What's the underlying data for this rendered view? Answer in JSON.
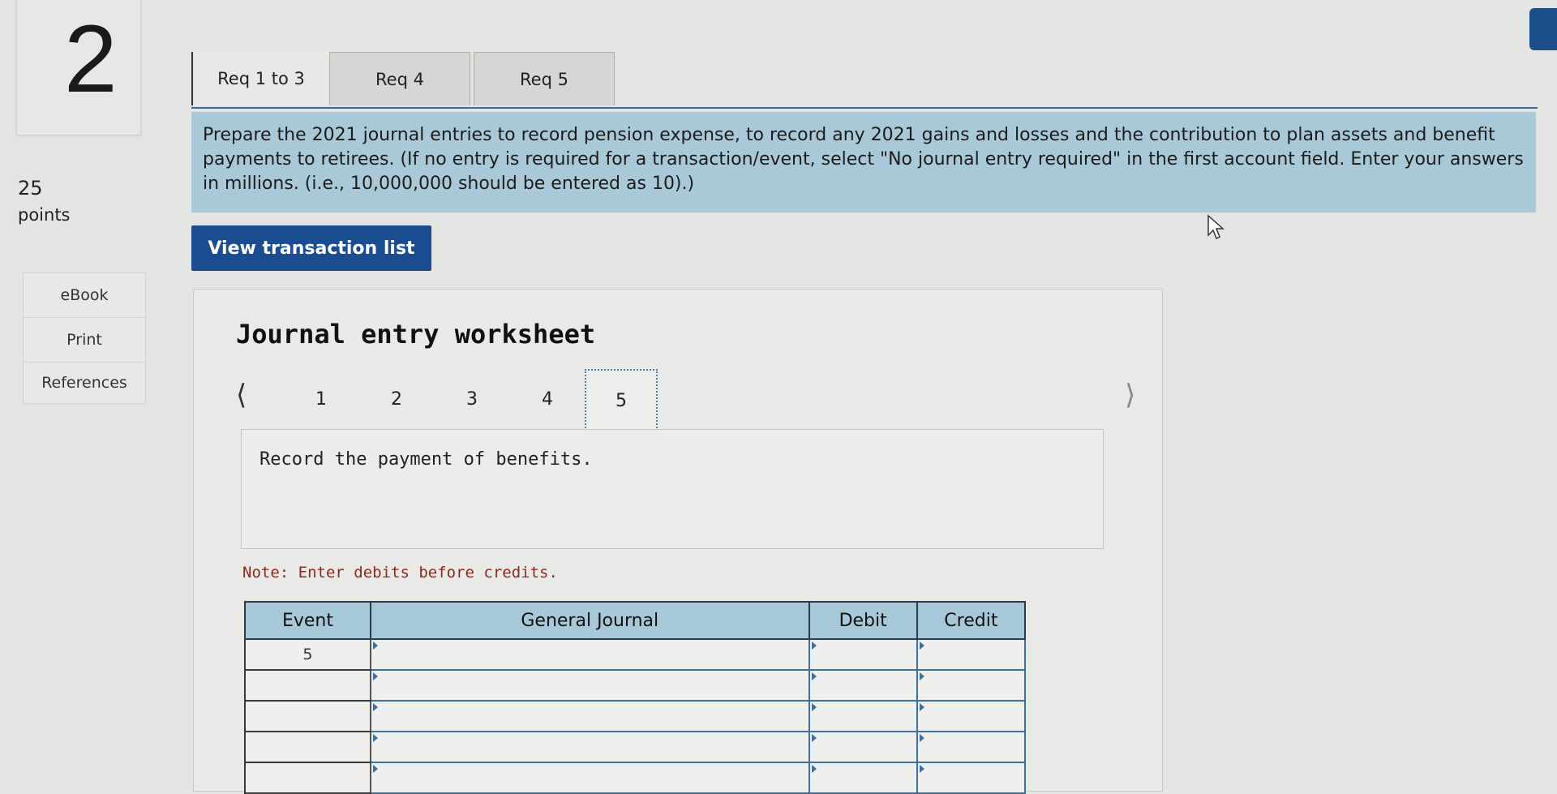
{
  "question": {
    "number": "2",
    "points_value": "25",
    "points_label": "points"
  },
  "sidebar": {
    "links": [
      "eBook",
      "Print",
      "References"
    ]
  },
  "tabs": [
    {
      "label": "Req 1 to 3",
      "active": true
    },
    {
      "label": "Req 4",
      "active": false
    },
    {
      "label": "Req 5",
      "active": false
    }
  ],
  "instructions": {
    "text": "Prepare the 2021 journal entries to record pension expense, to record any 2021 gains and losses and the contribution to plan assets and benefit payments to retirees. (If no entry is required for a transaction/event, select \"No journal entry required\" in the first account field. Enter your answers in millions. (i.e., 10,000,000 should be entered as 10).)"
  },
  "view_transaction_button": "View transaction list",
  "worksheet": {
    "title": "Journal entry worksheet",
    "pages": [
      "1",
      "2",
      "3",
      "4",
      "5"
    ],
    "selected_page": "5",
    "prompt": "Record the payment of benefits.",
    "note": "Note: Enter debits before credits.",
    "table": {
      "headers": [
        "Event",
        "General Journal",
        "Debit",
        "Credit"
      ],
      "rows": [
        {
          "event": "5",
          "account": "",
          "debit": "",
          "credit": ""
        },
        {
          "event": "",
          "account": "",
          "debit": "",
          "credit": ""
        },
        {
          "event": "",
          "account": "",
          "debit": "",
          "credit": ""
        },
        {
          "event": "",
          "account": "",
          "debit": "",
          "credit": ""
        },
        {
          "event": "",
          "account": "",
          "debit": "",
          "credit": ""
        }
      ]
    }
  },
  "colors": {
    "instruction_bg": "#a9c9d8",
    "button_bg": "#1a4d8f",
    "table_header_bg": "#a7c8d9",
    "note_text": "#8b2a1f"
  },
  "icons": {
    "pager_prev": "chevron-left-icon",
    "pager_next": "chevron-right-icon",
    "cursor": "mouse-pointer-icon"
  }
}
